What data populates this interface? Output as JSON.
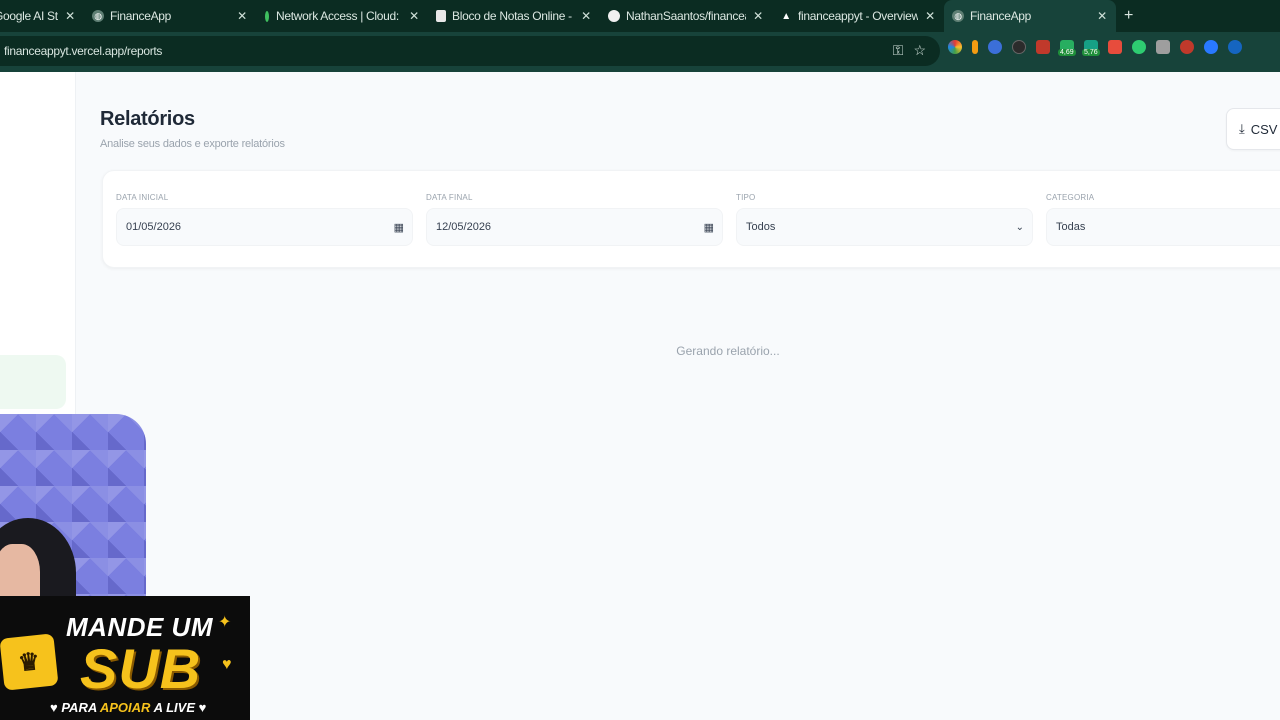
{
  "browser": {
    "tabs": [
      {
        "title": "Google AI Studio",
        "favicon": "ai-studio-icon"
      },
      {
        "title": "FinanceApp",
        "favicon": "globe-icon"
      },
      {
        "title": "Network Access | Cloud: Mong",
        "favicon": "mongodb-leaf-icon"
      },
      {
        "title": "Bloco de Notas Online - Crie e",
        "favicon": "notepad-icon"
      },
      {
        "title": "NathanSaantos/financeappyt: a",
        "favicon": "github-icon"
      },
      {
        "title": "financeappyt - Overview - Verc",
        "favicon": "vercel-icon"
      },
      {
        "title": "FinanceApp",
        "favicon": "globe-icon",
        "active": true
      }
    ],
    "new_tab": "+",
    "url": "financeappyt.vercel.app/reports",
    "extension_badges": [
      "4,69",
      "5,76"
    ]
  },
  "reports": {
    "title": "Relatórios",
    "subtitle": "Analise seus dados e exporte relatórios",
    "csv_label": "CSV",
    "filters": {
      "start_date_label": "DATA INICIAL",
      "start_date_value": "01/05/2026",
      "end_date_label": "DATA FINAL",
      "end_date_value": "12/05/2026",
      "type_label": "TIPO",
      "type_value": "Todos",
      "category_label": "CATEGORIA",
      "category_value": "Todas"
    },
    "loading_text": "Gerando relatório..."
  },
  "overlay": {
    "line1": "MANDE UM",
    "line2": "SUB",
    "line3_a": "PARA",
    "line3_b": "APOIAR",
    "line3_c": "A LIVE"
  },
  "colors": {
    "tabstrip": "#0b2c22",
    "toolbar": "#17433a",
    "page_bg": "#f8fafc",
    "accent_yellow": "#f6c21c"
  }
}
